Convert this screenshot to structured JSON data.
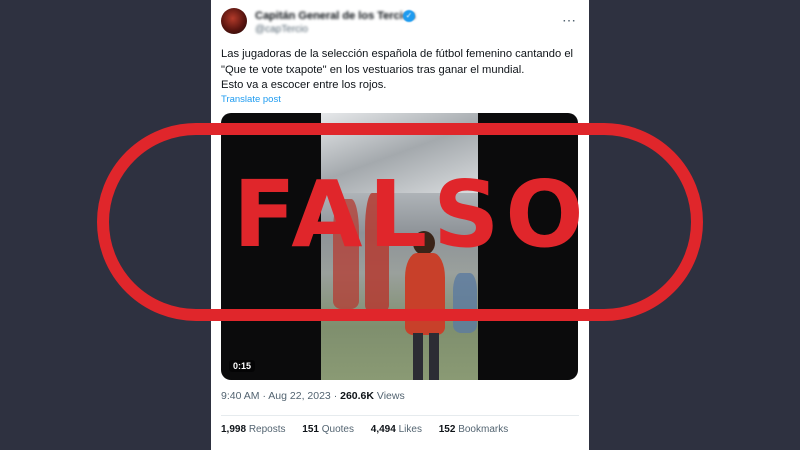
{
  "tweet": {
    "author_name": "Capitán General de los Tercios",
    "author_handle": "@capTercio",
    "verified_icon": "verified-badge-icon",
    "more_icon": "more-dots-icon",
    "text_lines": [
      "Las jugadoras de la selección española de fútbol femenino cantando el",
      "\"Que te vote txapote\" en los vestuarios tras ganar el mundial.",
      "Esto va a escocer entre los rojos."
    ],
    "translate_label": "Translate post",
    "video": {
      "timestamp": "0:15"
    },
    "meta": {
      "time": "9:40 AM",
      "date": "Aug 22, 2023",
      "views_count": "260.6K",
      "views_label": "Views"
    },
    "stats": [
      {
        "count": "1,998",
        "label": "Reposts"
      },
      {
        "count": "151",
        "label": "Quotes"
      },
      {
        "count": "4,494",
        "label": "Likes"
      },
      {
        "count": "152",
        "label": "Bookmarks"
      }
    ]
  },
  "stamp": {
    "text": "FALSO",
    "color": "#e0262b"
  },
  "colors": {
    "background": "#2e3140",
    "accent": "#1d9bf0"
  }
}
